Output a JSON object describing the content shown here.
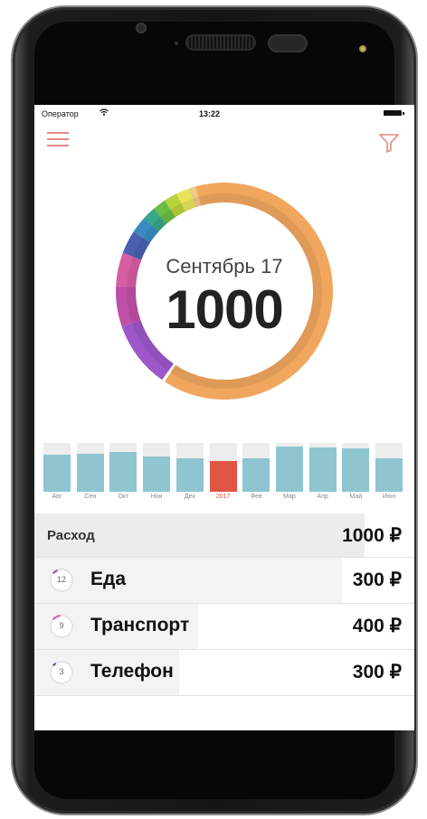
{
  "status_bar": {
    "carrier": "Оператор",
    "time": "13:22"
  },
  "toolbar": {
    "menu_icon": "hamburger-menu-icon",
    "filter_icon": "filter-funnel-icon"
  },
  "summary": {
    "month": "Сентябрь 17",
    "amount": "1000"
  },
  "ring_segments": [
    {
      "color": "#9e57c9",
      "fraction": 0.1
    },
    {
      "color": "#c04fa8",
      "fraction": 0.06
    },
    {
      "color": "#d65ea3",
      "fraction": 0.05
    },
    {
      "color": "#4a5fb0",
      "fraction": 0.035
    },
    {
      "color": "#3a8ac0",
      "fraction": 0.025
    },
    {
      "color": "#37a785",
      "fraction": 0.02
    },
    {
      "color": "#6bbd43",
      "fraction": 0.02
    },
    {
      "color": "#b8d23a",
      "fraction": 0.02
    },
    {
      "color": "#e8e45a",
      "fraction": 0.02
    },
    {
      "color": "#f0c888",
      "fraction": 0.01
    },
    {
      "color": "#f1a65e",
      "fraction": 0.635
    }
  ],
  "chart_data": {
    "type": "bar",
    "categories": [
      "Авг",
      "Сен",
      "Окт",
      "Ноя",
      "Дек",
      "2017",
      "Фев",
      "Мар",
      "Апр",
      "Май",
      "Июн"
    ],
    "values": [
      0.76,
      0.78,
      0.82,
      0.72,
      0.68,
      0.63,
      0.68,
      0.92,
      0.9,
      0.88,
      0.68
    ],
    "highlight_index": 5,
    "bar_color": "#8ec5d0",
    "highlight_color": "#e05544",
    "ylim": [
      0,
      1
    ]
  },
  "expenses": {
    "total_label": "Расход",
    "total_value": "1000 ₽",
    "total_white_fraction": 0.13,
    "items": [
      {
        "count": "12",
        "label": "Еда",
        "value": "300 ₽",
        "color": "#9e57c9",
        "level": 0.08,
        "white_fraction": 0.19
      },
      {
        "count": "9",
        "label": "Транспорт",
        "value": "400 ₽",
        "color": "#d65ea3",
        "level": 0.12,
        "white_fraction": 0.57
      },
      {
        "count": "3",
        "label": "Телефон",
        "value": "300 ₽",
        "color": "#4a5fb0",
        "level": 0.05,
        "white_fraction": 0.62
      }
    ]
  }
}
